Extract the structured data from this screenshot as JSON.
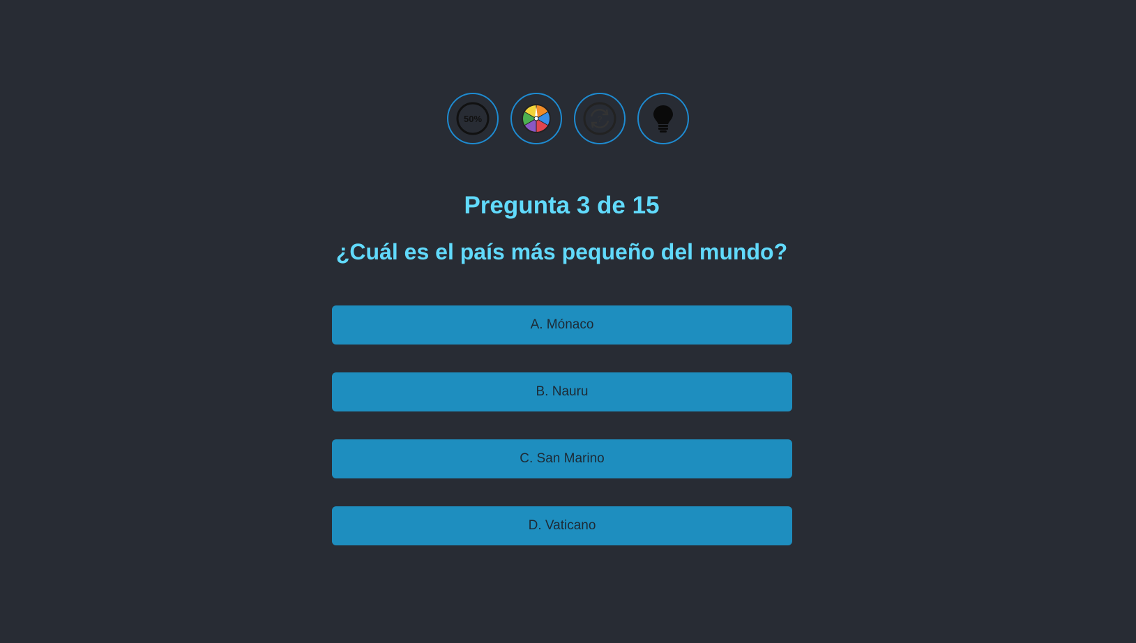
{
  "lifelines": [
    {
      "name": "fifty-fifty",
      "label": "50%",
      "icon": "fifty-percent-icon"
    },
    {
      "name": "wheel",
      "icon": "color-wheel-icon"
    },
    {
      "name": "change-question",
      "icon": "refresh-question-icon"
    },
    {
      "name": "hint",
      "icon": "lightbulb-icon"
    }
  ],
  "question": {
    "counter": "Pregunta 3 de 15",
    "text": "¿Cuál es el país más pequeño del mundo?"
  },
  "answers": [
    {
      "label": "A. Mónaco"
    },
    {
      "label": "B. Nauru"
    },
    {
      "label": "C. San Marino"
    },
    {
      "label": "D. Vaticano"
    }
  ],
  "colors": {
    "background": "#282c34",
    "accent": "#61dafb",
    "lifeline_border": "#1e8bd1",
    "answer_bg": "#1e8ebf",
    "answer_text": "#1d2a35"
  }
}
